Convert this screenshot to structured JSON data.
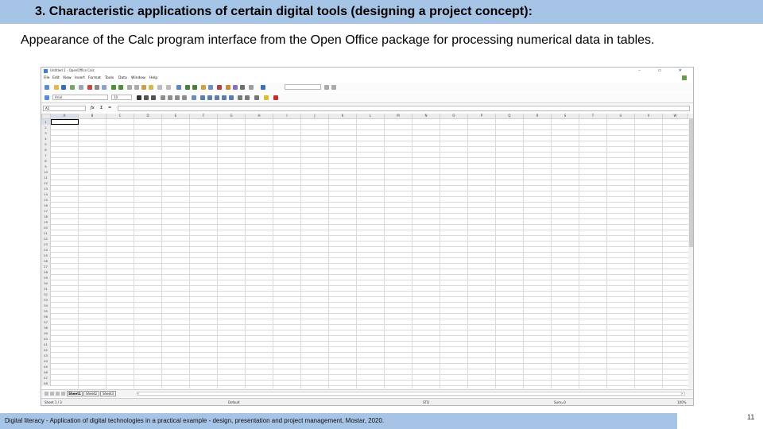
{
  "slide": {
    "title": "3. Characteristic applications of certain digital tools (designing a project concept):",
    "subtitle": "Appearance of the Calc program interface from the Open Office package for processing numerical data in tables.",
    "footer": "Digital literacy - Application of digital technologies in a practical example - design, presentation and project management, Mostar, 2020.",
    "page_number": "11"
  },
  "calc": {
    "window_title": "Untitled 1 - OpenOffice Calc",
    "window_controls": "– ▭ ✕",
    "menu": [
      "File",
      "Edit",
      "View",
      "Insert",
      "Format",
      "Tools",
      "Data",
      "Window",
      "Help"
    ],
    "font_name": "Arial",
    "font_size": "10",
    "name_box": "A1",
    "fx_symbol": "ƒx",
    "sum_symbol": "Σ",
    "equals_symbol": "=",
    "columns": [
      "A",
      "B",
      "C",
      "D",
      "E",
      "F",
      "G",
      "H",
      "I",
      "J",
      "K",
      "L",
      "M",
      "N",
      "O",
      "P",
      "Q",
      "R",
      "S",
      "T",
      "U",
      "V",
      "W"
    ],
    "rows": [
      "1",
      "2",
      "3",
      "4",
      "5",
      "6",
      "7",
      "8",
      "9",
      "10",
      "11",
      "12",
      "13",
      "14",
      "15",
      "16",
      "17",
      "18",
      "19",
      "20",
      "21",
      "22",
      "23",
      "24",
      "25",
      "26",
      "27",
      "28",
      "29",
      "30",
      "31",
      "32",
      "33",
      "34",
      "35",
      "36",
      "37",
      "38",
      "39",
      "40",
      "41",
      "42",
      "43",
      "44",
      "45",
      "46",
      "47",
      "48"
    ],
    "sheets": [
      "Sheet1",
      "Sheet2",
      "Sheet3"
    ],
    "status": {
      "sheet": "Sheet 1 / 3",
      "style": "Default",
      "mode": "STD",
      "sum": "Sum=0",
      "zoom": "100%"
    },
    "accent_color": "#a6c4e6"
  }
}
